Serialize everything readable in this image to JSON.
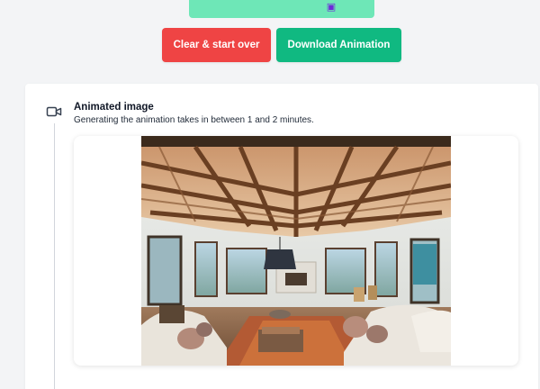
{
  "top_button": {
    "icon": "image-icon"
  },
  "actions": {
    "clear_label": "Clear & start over",
    "download_label": "Download Animation"
  },
  "section": {
    "icon": "video-camera-icon",
    "title": "Animated image",
    "description": "Generating the animation takes in between 1 and 2 minutes."
  },
  "colors": {
    "red": "#ef4444",
    "green": "#10b981",
    "light_green": "#6ee7b7",
    "background": "#f3f4f6"
  }
}
